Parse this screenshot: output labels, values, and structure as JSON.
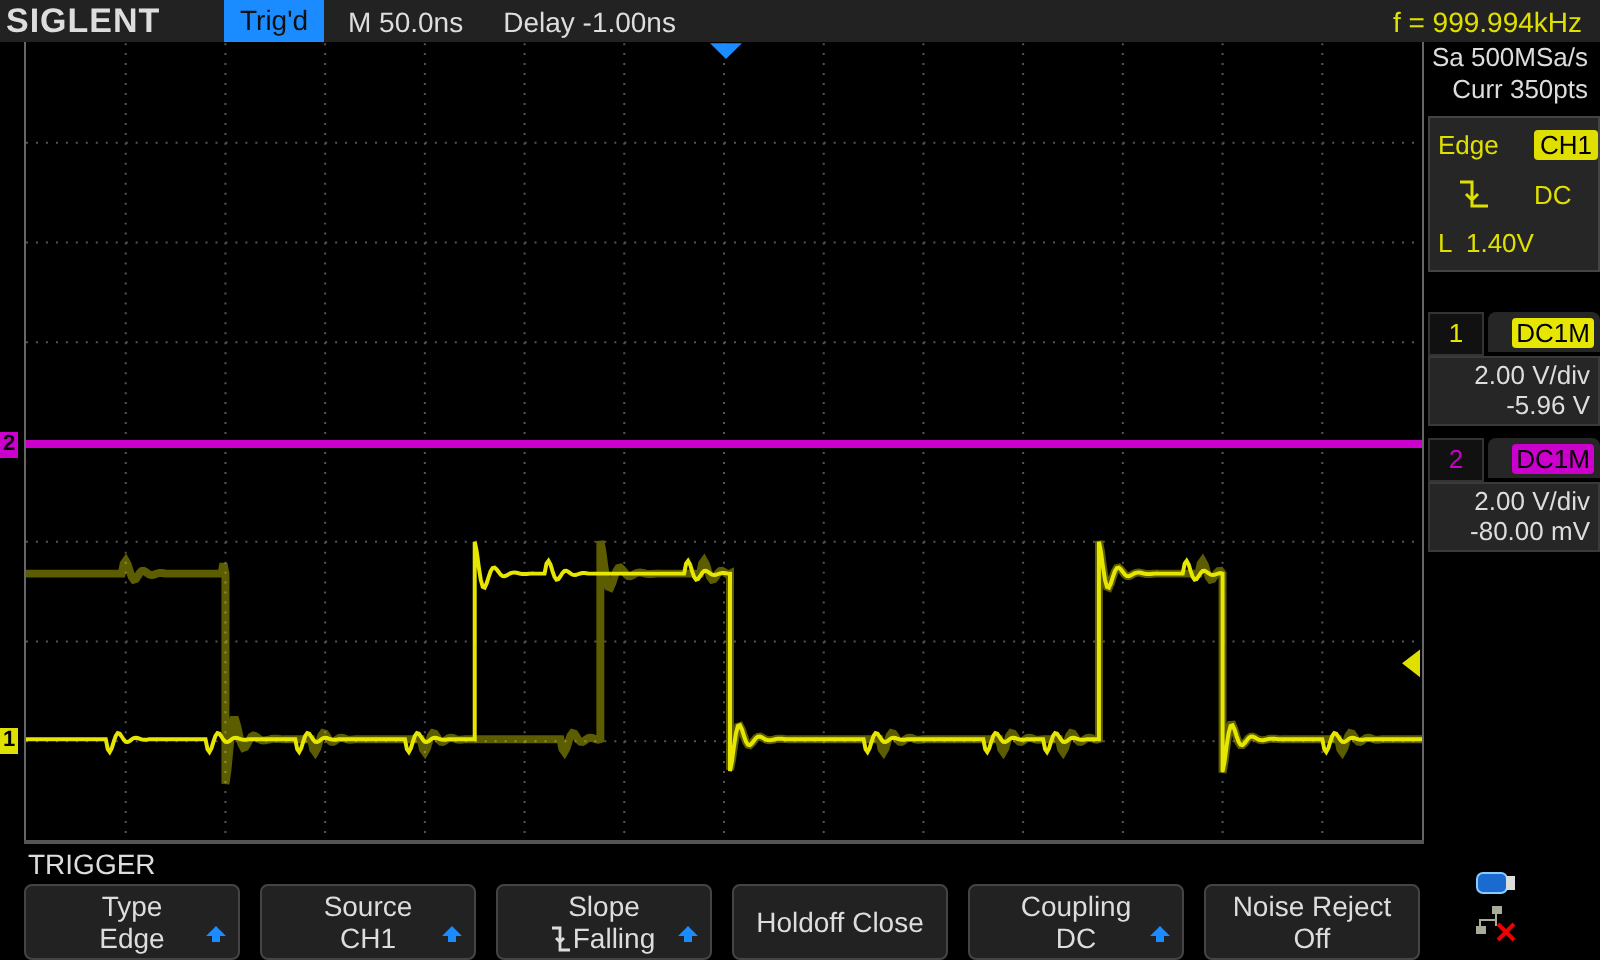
{
  "top_bar": {
    "logo": "SIGLENT",
    "trigger_status": "Trig'd",
    "timebase": "M 50.0ns",
    "delay": "Delay -1.00ns",
    "frequency": "f = 999.994kHz"
  },
  "channel_markers": [
    {
      "label": "2",
      "color": "#cc00cc"
    },
    {
      "label": "1",
      "color": "#e0e000"
    }
  ],
  "side_panel": {
    "sample_rate": "Sa 500MSa/s",
    "memory": "Curr 350pts",
    "trigger": {
      "type": "Edge",
      "source": "CH1",
      "coupling": "DC",
      "level": "L  1.40V"
    },
    "channels": [
      {
        "number": "1",
        "coupling": "DC1M",
        "scale": "2.00 V/div",
        "offset": "-5.96 V",
        "color": "#e6e600"
      },
      {
        "number": "2",
        "coupling": "DC1M",
        "scale": "2.00 V/div",
        "offset": "-80.00 mV",
        "color": "#cc00cc"
      }
    ]
  },
  "menu": {
    "title": "TRIGGER",
    "buttons": [
      {
        "label": "Type",
        "value": "Edge",
        "kind": "select"
      },
      {
        "label": "Source",
        "value": "CH1",
        "kind": "select"
      },
      {
        "label": "Slope",
        "value": "Falling",
        "kind": "slope"
      },
      {
        "label": "Holdoff Close",
        "kind": "single"
      },
      {
        "label": "Coupling",
        "value": "DC",
        "kind": "select"
      },
      {
        "label": "Noise Reject",
        "value": "Off",
        "kind": "plain"
      }
    ]
  }
}
